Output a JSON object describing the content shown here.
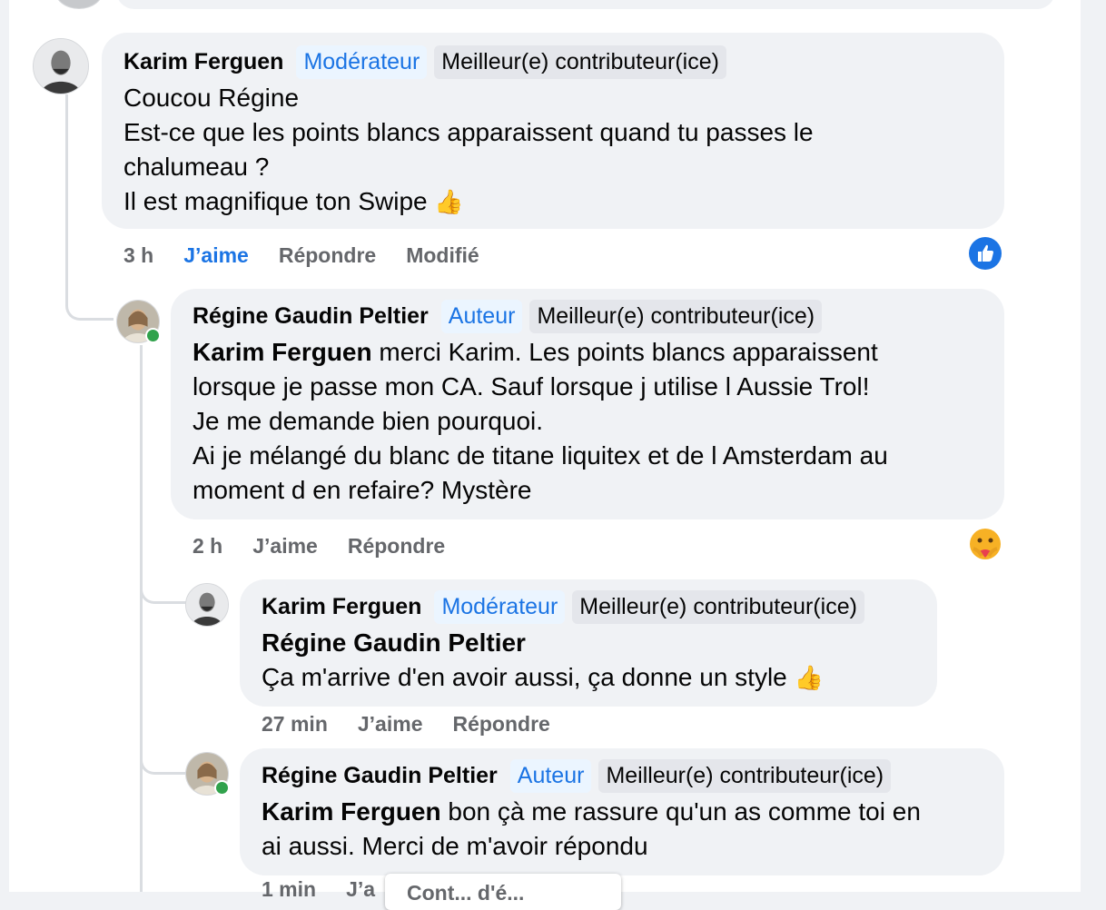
{
  "comments": [
    {
      "author": "Karim Ferguen",
      "role": "Modérateur",
      "badge": "Meilleur(e) contributeur(ice)",
      "lines": [
        "Coucou Régine",
        "Est-ce que les points blancs apparaissent quand tu passes le",
        "chalumeau ?",
        "Il est magnifique ton Swipe"
      ],
      "emoji": "👍",
      "time": "3 h",
      "like": "J’aime",
      "reply": "Répondre",
      "edited": "Modifié",
      "reaction_icon": "like-reaction-icon"
    },
    {
      "author": "Régine Gaudin Peltier",
      "role": "Auteur",
      "badge": "Meilleur(e) contributeur(ice)",
      "mention": "Karim Ferguen",
      "first_line": "merci Karim. Les points blancs apparaissent",
      "lines": [
        "lorsque je passe mon CA. Sauf lorsque j utilise l Aussie Trol!",
        "Je me demande bien pourquoi.",
        "Ai je mélangé du blanc de titane liquitex et de l Amsterdam au",
        "moment d en refaire? Mystère"
      ],
      "time": "2 h",
      "like": "J’aime",
      "reply": "Répondre",
      "reaction_icon": "care-reaction-icon"
    },
    {
      "author": "Karim Ferguen",
      "role": "Modérateur",
      "badge": "Meilleur(e) contributeur(ice)",
      "mention": "Régine Gaudin Peltier",
      "lines": [
        "Ça m'arrive d'en avoir aussi, ça donne un style"
      ],
      "emoji": "👍",
      "time": "27 min",
      "like": "J’aime",
      "reply": "Répondre"
    },
    {
      "author": "Régine Gaudin Peltier",
      "role": "Auteur",
      "badge": "Meilleur(e) contributeur(ice)",
      "mention": "Karim Ferguen",
      "first_line": "bon çà me rassure qu'un as comme toi en",
      "lines": [
        "ai aussi. Merci de m'avoir répondu"
      ],
      "time": "1 min",
      "like": "J’a"
    }
  ],
  "popup": {
    "label": "Cont... d'é..."
  },
  "colors": {
    "accent": "#1b74e4",
    "bubble": "#f0f2f5",
    "meta": "#65676b",
    "online": "#31a24c"
  }
}
